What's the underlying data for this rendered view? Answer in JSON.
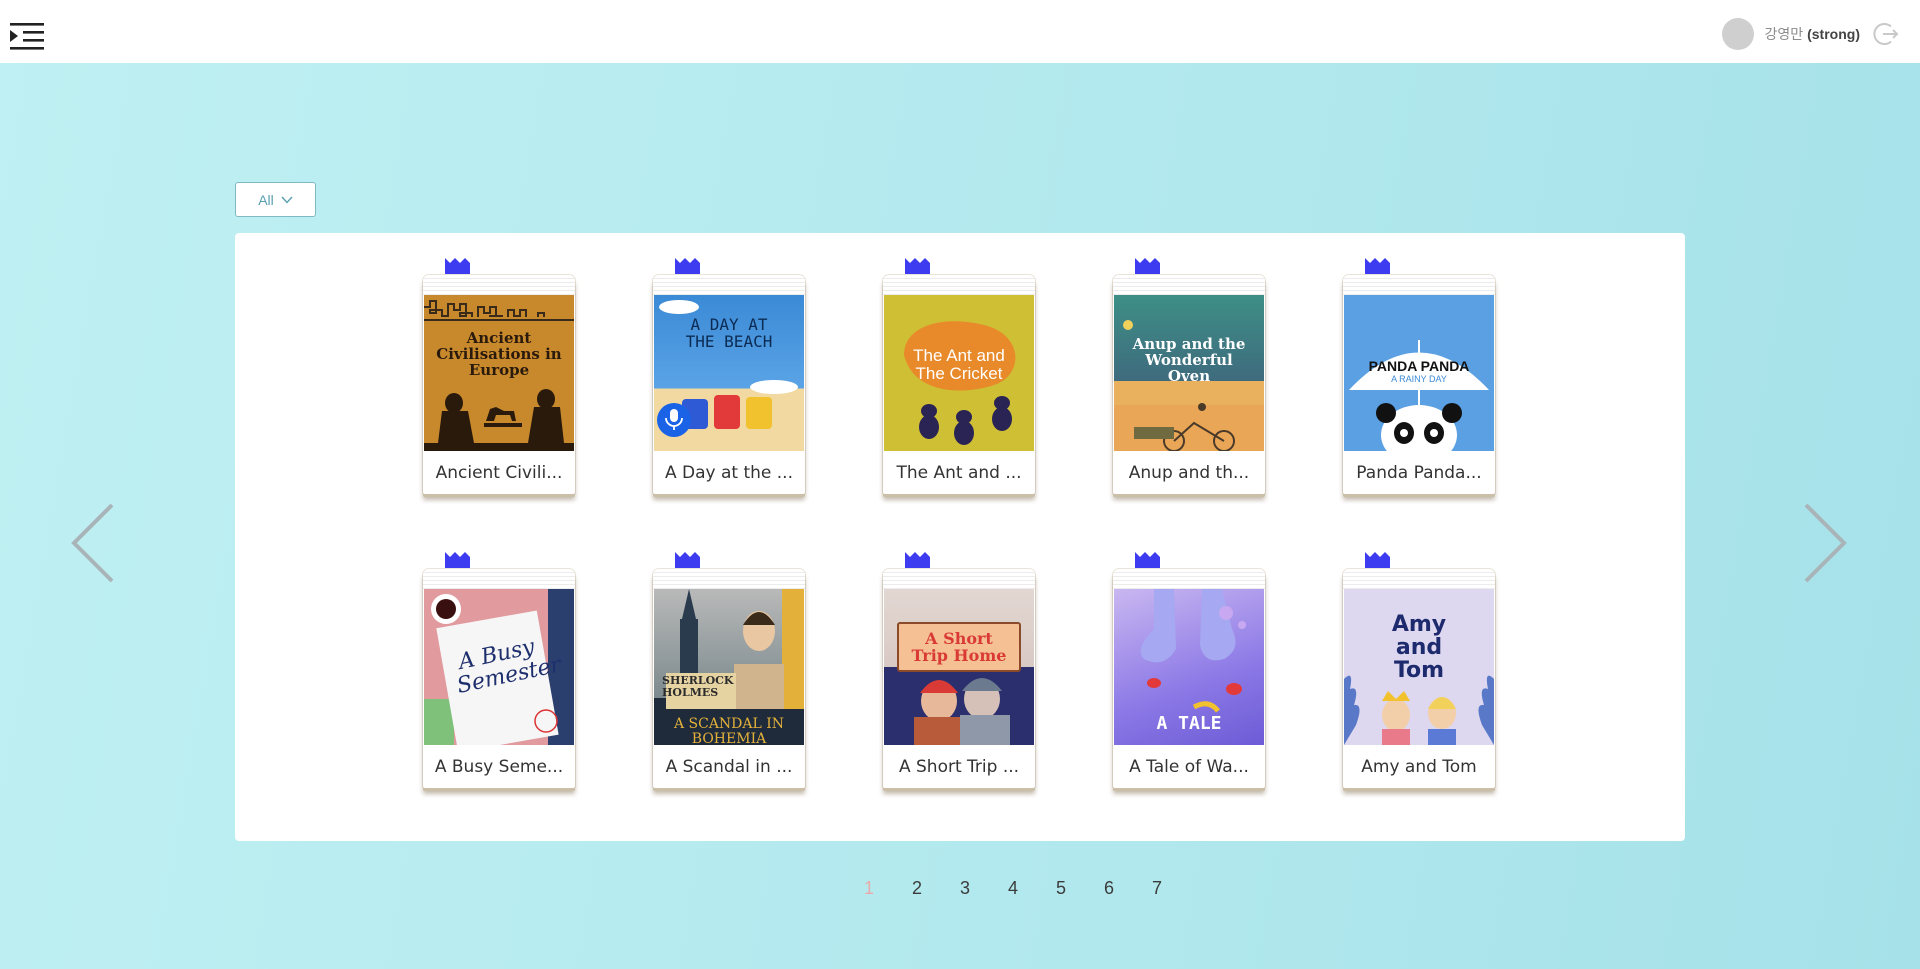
{
  "header": {
    "user_name": "강영만",
    "user_level": "(strong)"
  },
  "filter": {
    "selected": "All"
  },
  "books": [
    {
      "title": "Ancient Civili...",
      "cover_title": "Ancient Civilisations in Europe"
    },
    {
      "title": "A Day at the ...",
      "cover_title": "A DAY AT THE BEACH"
    },
    {
      "title": "The Ant and ...",
      "cover_title": "The Ant and The Cricket"
    },
    {
      "title": "Anup and th...",
      "cover_title": "Anup and the Wonderful Oven"
    },
    {
      "title": "Panda Panda...",
      "cover_title": "PANDA PANDA",
      "cover_subtitle": "A RAINY DAY"
    },
    {
      "title": "A Busy Seme...",
      "cover_title": "A Busy Semester"
    },
    {
      "title": "A Scandal in ...",
      "cover_title": "SHERLOCK HOLMES",
      "cover_subtitle": "A SCANDAL IN BOHEMIA"
    },
    {
      "title": "A Short Trip ...",
      "cover_title": "A Short Trip Home"
    },
    {
      "title": "A Tale of Wa...",
      "cover_title": "A TALE"
    },
    {
      "title": "Amy and Tom",
      "cover_title": "Amy and Tom"
    }
  ],
  "pagination": {
    "current": "1",
    "pages": [
      "1",
      "2",
      "3",
      "4",
      "5",
      "6",
      "7"
    ]
  },
  "colors": {
    "flag": "#3d3cf0",
    "background": "#b4ebef",
    "current_page": "#e9aaa9"
  },
  "icons": {
    "menu": "menu-indent-icon",
    "logout": "logout-icon",
    "filter": "chevron-down-icon",
    "prev": "chevron-left-icon",
    "next": "chevron-right-icon",
    "book_flag": "crown-flag-icon"
  }
}
